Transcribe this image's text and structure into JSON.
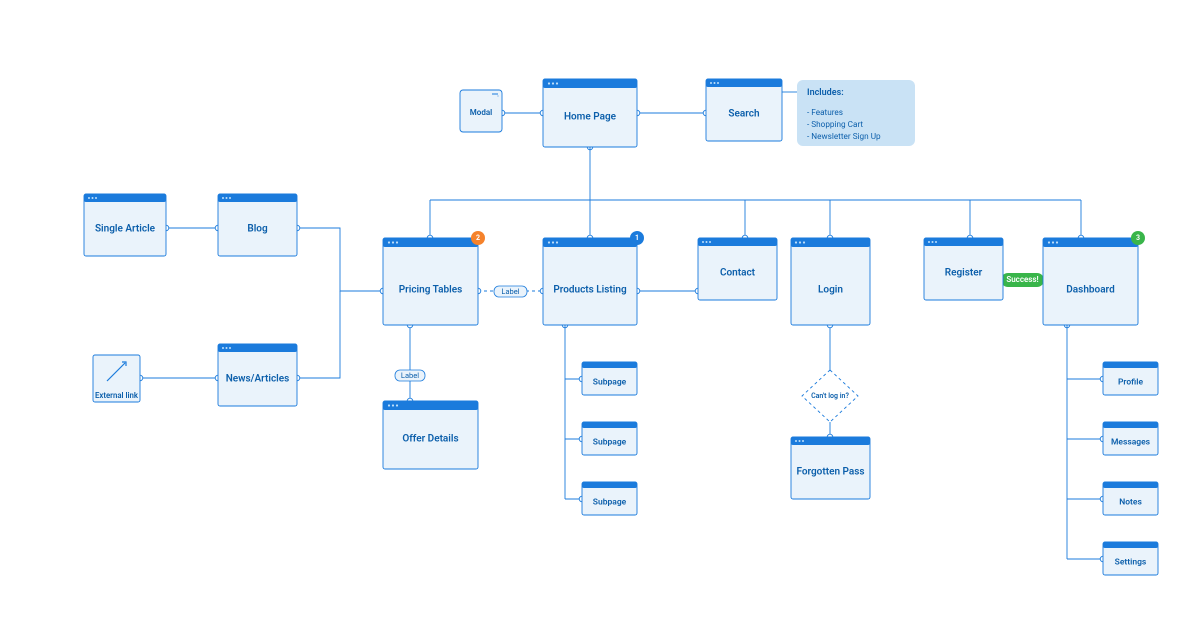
{
  "nodes": {
    "home": "Home Page",
    "search": "Search",
    "single_article": "Single Article",
    "blog": "Blog",
    "news": "News/Articles",
    "pricing": "Pricing Tables",
    "products": "Products Listing",
    "contact": "Contact",
    "login": "Login",
    "register": "Register",
    "dashboard": "Dashboard",
    "offer": "Offer Details",
    "forgotten": "Forgotten Pass",
    "modal": "Modal",
    "external": "External link"
  },
  "subpages": {
    "s1": "Subpage",
    "s2": "Subpage",
    "s3": "Subpage"
  },
  "dashboard_sub": {
    "profile": "Profile",
    "messages": "Messages",
    "notes": "Notes",
    "settings": "Settings"
  },
  "decision": {
    "cant_login": "Can't log in?"
  },
  "labels": {
    "conn_label_1": "Label",
    "conn_label_2": "Label",
    "success": "Success!"
  },
  "badges": {
    "pricing": "2",
    "products": "1",
    "dashboard": "3"
  },
  "callout": {
    "title": "Includes:",
    "items": [
      "- Features",
      "- Shopping Cart",
      "- Newsletter Sign Up"
    ]
  }
}
